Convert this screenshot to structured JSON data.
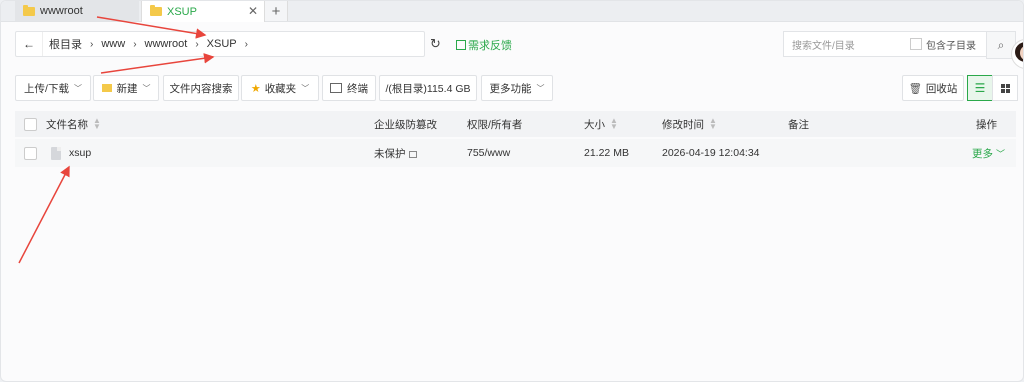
{
  "tabs": [
    {
      "label": "wwwroot"
    },
    {
      "label": "XSUP",
      "close": "✕"
    }
  ],
  "tab_add": "+",
  "address": {
    "back": "←",
    "crumbs": [
      "根目录",
      "www",
      "wwwroot",
      "XSUP"
    ],
    "separator": "›",
    "refresh": "↻",
    "feedback": "需求反馈"
  },
  "search": {
    "placeholder": "搜索文件/目录",
    "include_sub": "包含子目录",
    "button": "⌕"
  },
  "toolbar": {
    "upload": "上传/下载",
    "new": "新建",
    "content_search": "文件内容搜索",
    "favorites": "收藏夹",
    "terminal": "终端",
    "disk": "/(根目录)115.4 GB",
    "more": "更多功能",
    "recycle": "回收站"
  },
  "table": {
    "headers": {
      "name": "文件名称",
      "protect": "企业级防篡改",
      "perm": "权限/所有者",
      "size": "大小",
      "mtime": "修改时间",
      "note": "备注",
      "action": "操作"
    },
    "rows": [
      {
        "name": "xsup",
        "protect": "未保护",
        "perm": "755/www",
        "size": "21.22 MB",
        "mtime": "2026-04-19 12:04:34",
        "note": "",
        "action": "更多"
      }
    ]
  },
  "colors": {
    "accent": "#2aa84a",
    "annotation": "#e8453c"
  }
}
